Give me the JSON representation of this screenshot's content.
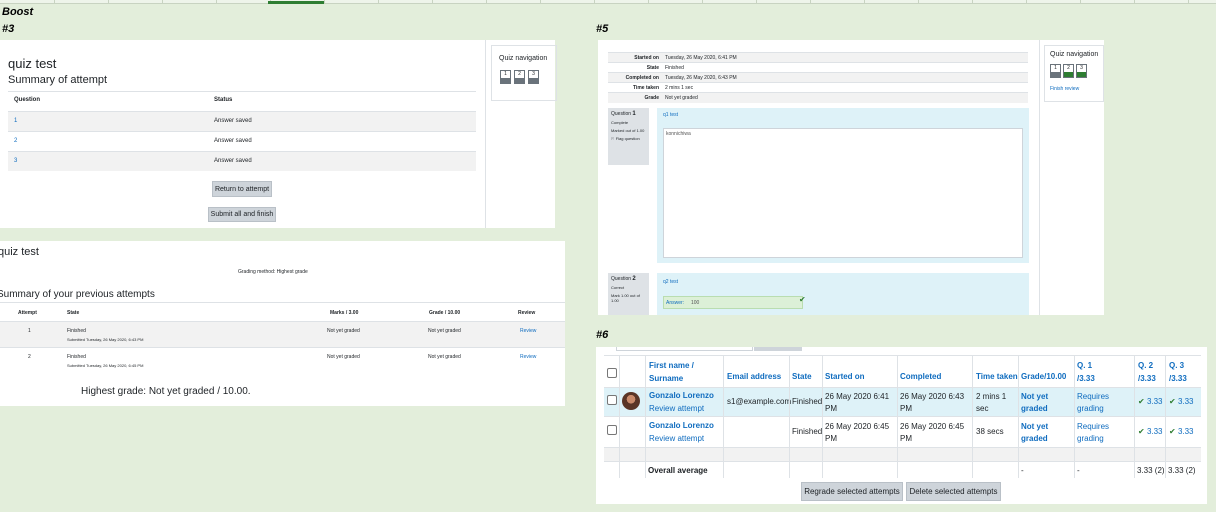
{
  "labels": {
    "boost": "Boost",
    "s3": "#3",
    "s5": "#5",
    "s6": "#6"
  },
  "summary": {
    "quiz_title": "quiz test",
    "heading": "Summary of attempt",
    "col_question": "Question",
    "col_status": "Status",
    "rows": [
      {
        "q": "1",
        "status": "Answer saved"
      },
      {
        "q": "2",
        "status": "Answer saved"
      },
      {
        "q": "3",
        "status": "Answer saved"
      }
    ],
    "return_button": "Return to attempt",
    "submit_button": "Submit all and finish",
    "nav_title": "Quiz navigation",
    "nav_items": [
      "1",
      "2",
      "3"
    ]
  },
  "previous": {
    "quiz_title": "quiz test",
    "grading_method": "Grading method: Highest grade",
    "heading": "Summary of your previous attempts",
    "headers": [
      "Attempt",
      "State",
      "Marks / 3.00",
      "Grade / 10.00",
      "Review"
    ],
    "rows": [
      {
        "attempt": "1",
        "state": "Finished",
        "submitted": "Submitted Tuesday, 26 May 2020, 6:43 PM",
        "marks": "Not yet graded",
        "grade": "Not yet graded",
        "review": "Review"
      },
      {
        "attempt": "2",
        "state": "Finished",
        "submitted": "Submitted Tuesday, 26 May 2020, 6:45 PM",
        "marks": "Not yet graded",
        "grade": "Not yet graded",
        "review": "Review"
      }
    ],
    "highest": "Highest grade: Not yet graded / 10.00."
  },
  "review": {
    "info": [
      {
        "label": "Started on",
        "value": "Tuesday, 26 May 2020, 6:41 PM"
      },
      {
        "label": "State",
        "value": "Finished"
      },
      {
        "label": "Completed on",
        "value": "Tuesday, 26 May 2020, 6:43 PM"
      },
      {
        "label": "Time taken",
        "value": "2 mins 1 sec"
      },
      {
        "label": "Grade",
        "value": "Not yet graded"
      }
    ],
    "q1": {
      "question_word": "Question",
      "number": "1",
      "status": "Complete",
      "marked": "Marked out of 1.00",
      "flag": "Flag question",
      "text": "q1 test",
      "answer": "konnichiwa"
    },
    "q2": {
      "question_word": "Question",
      "number": "2",
      "status": "Correct",
      "mark": "Mark 1.00 out of 1.00",
      "text": "q2 test",
      "answer_label": "Answer:",
      "answer_value": "100"
    },
    "nav_title": "Quiz navigation",
    "nav_items": [
      "1",
      "2",
      "3"
    ],
    "finish_review": "Finish review"
  },
  "grades": {
    "headers": {
      "first_name": "First name /",
      "surname": "Surname",
      "email": "Email address",
      "state": "State",
      "started": "Started on",
      "completed": "Completed",
      "time": "Time taken",
      "grade": "Grade/10.00",
      "q1a": "Q. 1",
      "q1b": "/3.33",
      "q2a": "Q. 2",
      "q2b": "/3.33",
      "q3a": "Q. 3",
      "q3b": "/3.33"
    },
    "rows": [
      {
        "name": "Gonzalo Lorenzo",
        "review": "Review attempt",
        "email": "s1@example.com",
        "state": "Finished",
        "started_a": "26 May 2020 6:41",
        "started_b": "PM",
        "completed_a": "26 May 2020 6:43",
        "completed_b": "PM",
        "time_a": "2 mins 1",
        "time_b": "sec",
        "grade_a": "Not yet",
        "grade_b": "graded",
        "q1_a": "Requires",
        "q1_b": "grading",
        "q2": "3.33",
        "q3": "3.33"
      },
      {
        "name": "Gonzalo Lorenzo",
        "review": "Review attempt",
        "email": "",
        "state": "Finished",
        "started_a": "26 May 2020 6:45",
        "started_b": "PM",
        "completed_a": "26 May 2020 6:45",
        "completed_b": "PM",
        "time_a": "38 secs",
        "time_b": "",
        "grade_a": "Not yet",
        "grade_b": "graded",
        "q1_a": "Requires",
        "q1_b": "grading",
        "q2": "3.33",
        "q3": "3.33"
      }
    ],
    "overall": {
      "label": "Overall average",
      "grade": "-",
      "q1": "-",
      "q2": "3.33 (2)",
      "q3": "3.33 (2)"
    },
    "regrade_button": "Regrade selected attempts",
    "delete_button": "Delete selected attempts"
  }
}
